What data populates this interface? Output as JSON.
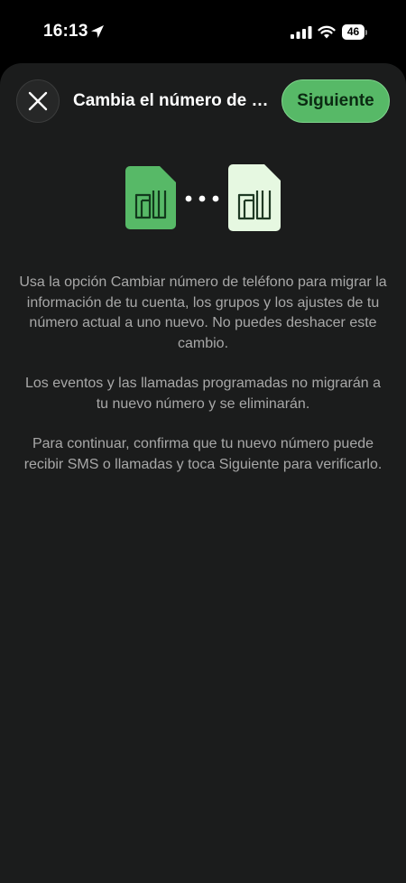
{
  "status_bar": {
    "time": "16:13",
    "battery": "46",
    "icons": [
      "location-arrow-icon",
      "cellular-signal-icon",
      "wifi-icon",
      "battery-icon"
    ]
  },
  "header": {
    "close_icon": "close-icon",
    "title": "Cambia el número de teléfono",
    "next_label": "Siguiente"
  },
  "illustration": {
    "icons": [
      "sim-card-old-icon",
      "ellipsis-dots-icon",
      "sim-card-new-icon"
    ]
  },
  "body": {
    "paragraphs": [
      "Usa la opción Cambiar número de teléfono para migrar la información de tu cuenta, los grupos y los ajustes de tu número actual a uno nuevo. No puedes deshacer este cambio.",
      "Los eventos y las llamadas programadas no migrarán a tu nuevo número y se eliminarán.",
      "Para continuar, confirma que tu nuevo número puede recibir SMS o llamadas y toca Siguiente para verificarlo."
    ]
  },
  "colors": {
    "background": "#000000",
    "sheet": "#1b1c1c",
    "accent_green": "#57b967",
    "light_green": "#e6f8e1",
    "text_primary": "#ffffff",
    "text_secondary": "#a8a8a8"
  }
}
